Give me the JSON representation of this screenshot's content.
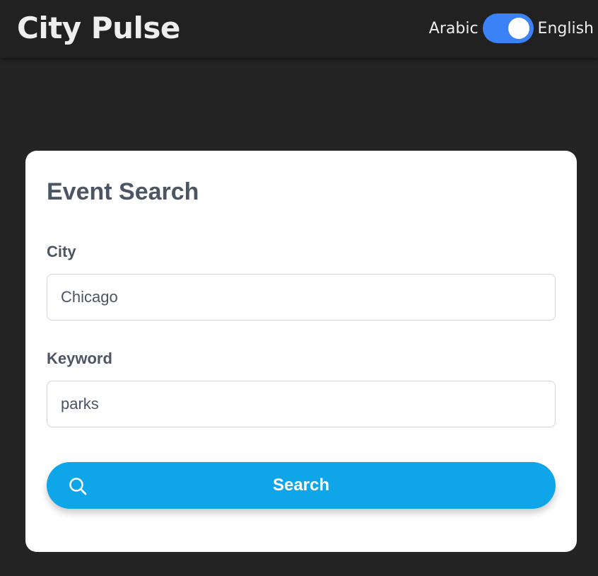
{
  "header": {
    "app_title": "City Pulse",
    "language_toggle": {
      "left_label": "Arabic",
      "right_label": "English",
      "selected": "English",
      "color": "#3b82f6"
    }
  },
  "form": {
    "title": "Event Search",
    "city": {
      "label": "City",
      "value": "Chicago"
    },
    "keyword": {
      "label": "Keyword",
      "value": "parks"
    },
    "search_button": {
      "label": "Search",
      "icon": "search-icon",
      "color": "#0ea5e9"
    }
  }
}
